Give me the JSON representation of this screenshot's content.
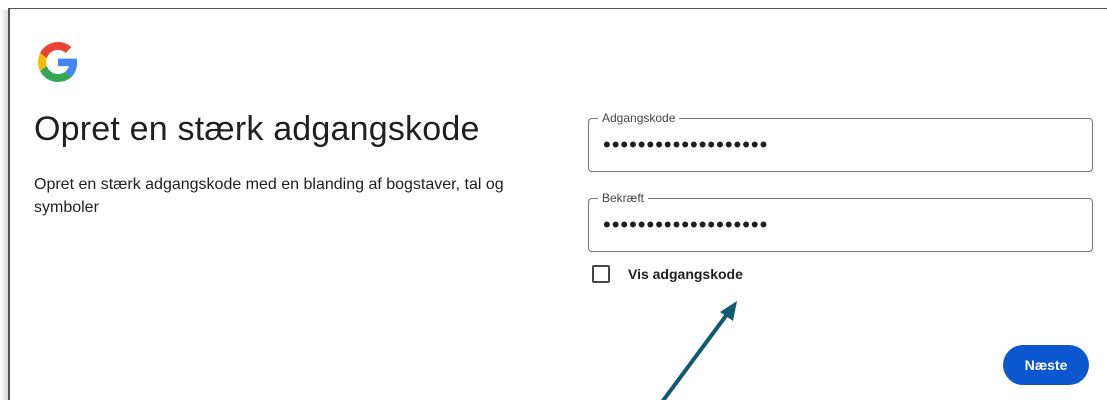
{
  "page": {
    "title": "Opret en stærk adgangskode",
    "subtitle": "Opret en stærk adgangskode med en blanding af bogstaver, tal og symboler"
  },
  "logo": {
    "icon": "google-g-icon",
    "colors": {
      "red": "#EA4335",
      "yellow": "#FBBC05",
      "green": "#34A853",
      "blue": "#4285F4"
    }
  },
  "form": {
    "password": {
      "label": "Adgangskode",
      "value": "•••••••••••••••••••"
    },
    "confirm": {
      "label": "Bekræft",
      "value": "•••••••••••••••••••"
    },
    "show_password": {
      "label": "Vis adgangskode",
      "checked": false
    },
    "next_label": "Næste"
  },
  "annotation": {
    "arrow_color": "#0e5a72"
  },
  "colors": {
    "primary_button": "#0b57d0",
    "text": "#1f1f1f"
  }
}
